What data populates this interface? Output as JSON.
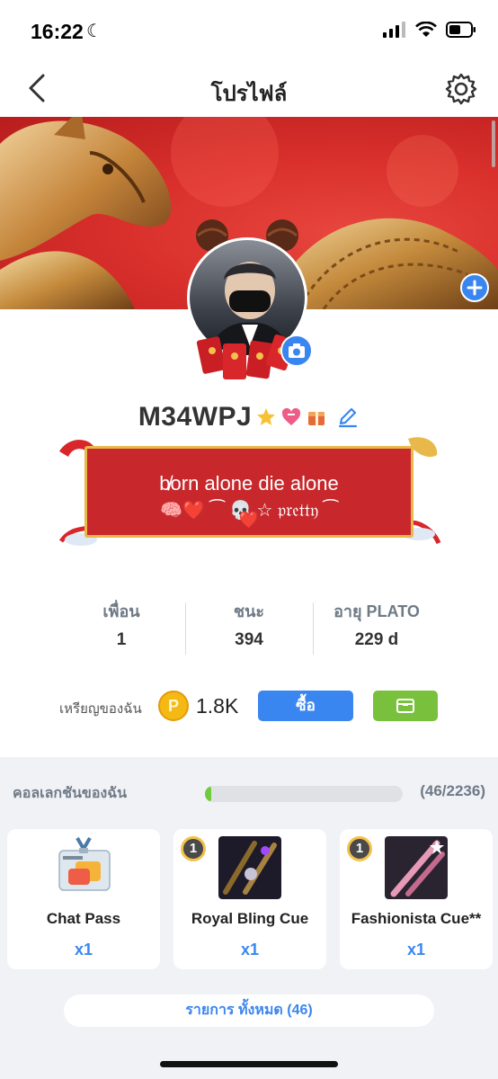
{
  "status_bar": {
    "time": "16:22"
  },
  "nav": {
    "title": "โปรไฟล์"
  },
  "profile": {
    "username": "M34WPJ",
    "bio_line1": "b̸orn alone die alone",
    "bio_line2": "🧠❤️ ⁀ 💀 ☆ 𝔭𝔯𝔢𝔱𝔱𝔶 ⁀",
    "bio_line3": "❤️"
  },
  "stats": [
    {
      "label": "เพื่อน",
      "value": "1"
    },
    {
      "label": "ชนะ",
      "value": "394"
    },
    {
      "label": "อายุ PLATO",
      "value": "229 d"
    }
  ],
  "coins": {
    "label": "เหรียญของฉัน",
    "coin_symbol": "P",
    "amount": "1.8K",
    "buy_label": "ซื้อ"
  },
  "collection": {
    "label": "คอลเลกชันของฉัน",
    "count": "(46/2236)",
    "progress_fraction": 0.0206,
    "items": [
      {
        "name": "Chat Pass",
        "qty": "x1",
        "icon": "chat-pass-icon"
      },
      {
        "name": "Royal Bling Cue",
        "qty": "x1",
        "badge": "1",
        "icon": "royal-cue-icon"
      },
      {
        "name": "Fashionista Cue**",
        "qty": "x1",
        "badge": "1",
        "icon": "fashion-cue-icon"
      }
    ],
    "all_button": "รายการ ทั้งหมด (46)"
  },
  "colors": {
    "accent": "#3a86f0",
    "green": "#79c03c",
    "banner_red": "#d9302c"
  }
}
